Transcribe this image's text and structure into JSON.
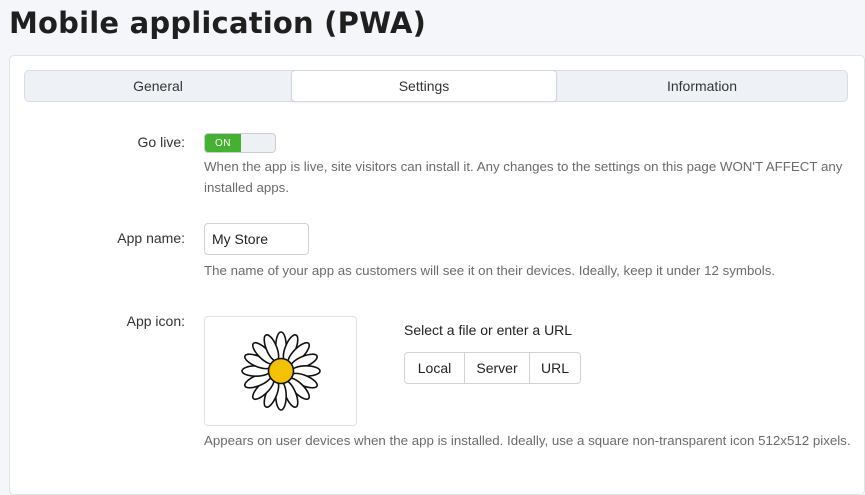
{
  "page": {
    "title": "Mobile application (PWA)"
  },
  "tabs": [
    {
      "label": "General"
    },
    {
      "label": "Settings"
    },
    {
      "label": "Information"
    }
  ],
  "fields": {
    "go_live": {
      "label": "Go live:",
      "toggle_state": "ON",
      "help": "When the app is live, site visitors can install it. Any changes to the settings on this page WON'T AFFECT any installed apps."
    },
    "app_name": {
      "label": "App name:",
      "value": "My Store",
      "help": "The name of your app as customers will see it on their devices. Ideally, keep it under 12 symbols."
    },
    "app_icon": {
      "label": "App icon:",
      "icon": "daisy-icon",
      "select_title": "Select a file or enter a URL",
      "buttons": [
        "Local",
        "Server",
        "URL"
      ],
      "help": "Appears on user devices when the app is installed. Ideally, use a square non-transparent icon 512x512 pixels."
    }
  },
  "colors": {
    "toggle_on": "#45b130",
    "daisy_center": "#f2c200"
  }
}
